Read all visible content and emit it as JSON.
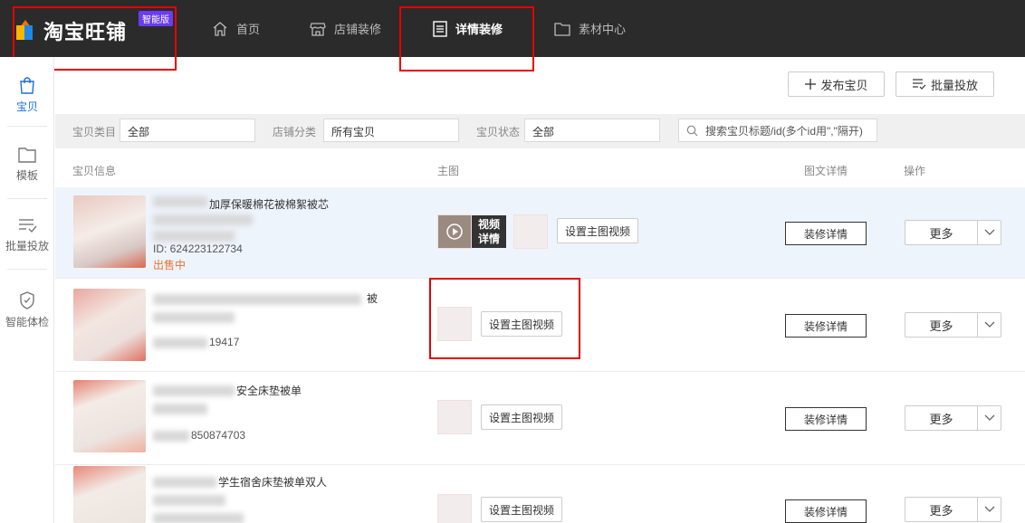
{
  "header": {
    "logo_text": "淘宝旺铺",
    "badge": "智能版",
    "nav": [
      {
        "label": "首页",
        "icon": "home-icon"
      },
      {
        "label": "店铺装修",
        "icon": "store-icon"
      },
      {
        "label": "详情装修",
        "icon": "document-icon",
        "active": true
      },
      {
        "label": "素材中心",
        "icon": "folder-icon"
      }
    ]
  },
  "sidebar": {
    "items": [
      {
        "label": "宝贝",
        "icon": "shopping-bag-icon",
        "active": true
      },
      {
        "label": "模板",
        "icon": "folder-icon"
      },
      {
        "label": "批量投放",
        "icon": "list-check-icon"
      },
      {
        "label": "智能体检",
        "icon": "shield-check-icon"
      }
    ]
  },
  "toolbar": {
    "publish_label": "发布宝贝",
    "batch_label": "批量投放"
  },
  "filters": {
    "category_label": "宝贝类目",
    "category_value": "全部",
    "shop_category_label": "店铺分类",
    "shop_category_value": "所有宝贝",
    "status_label": "宝贝状态",
    "status_value": "全部",
    "search_placeholder": "搜索宝贝标题/id(多个id用\",\"隔开)"
  },
  "table": {
    "headers": {
      "info": "宝贝信息",
      "main_image": "主图",
      "detail": "图文详情",
      "actions": "操作"
    },
    "rows": [
      {
        "title": "加厚保暖棉花被棉絮被芯",
        "id": "ID: 624223122734",
        "status": "出售中",
        "video_tag": "视频详情",
        "set_video": "设置主图视频",
        "decorate": "装修详情",
        "more": "更多"
      },
      {
        "title": "被",
        "id": "19417",
        "set_video": "设置主图视频",
        "decorate": "装修详情",
        "more": "更多"
      },
      {
        "title": "安全床垫被单",
        "id": "850874703",
        "set_video": "设置主图视频",
        "decorate": "装修详情",
        "more": "更多"
      },
      {
        "title": "学生宿舍床垫被单双人",
        "id": "",
        "set_video": "设置主图视频",
        "decorate": "装修详情",
        "more": "更多"
      }
    ]
  },
  "colors": {
    "topbar": "#2b2b2b",
    "accent": "#1b6fd6",
    "highlight_box": "#e60000",
    "status_sale": "#f07030",
    "badge": "#6b3cf0"
  }
}
